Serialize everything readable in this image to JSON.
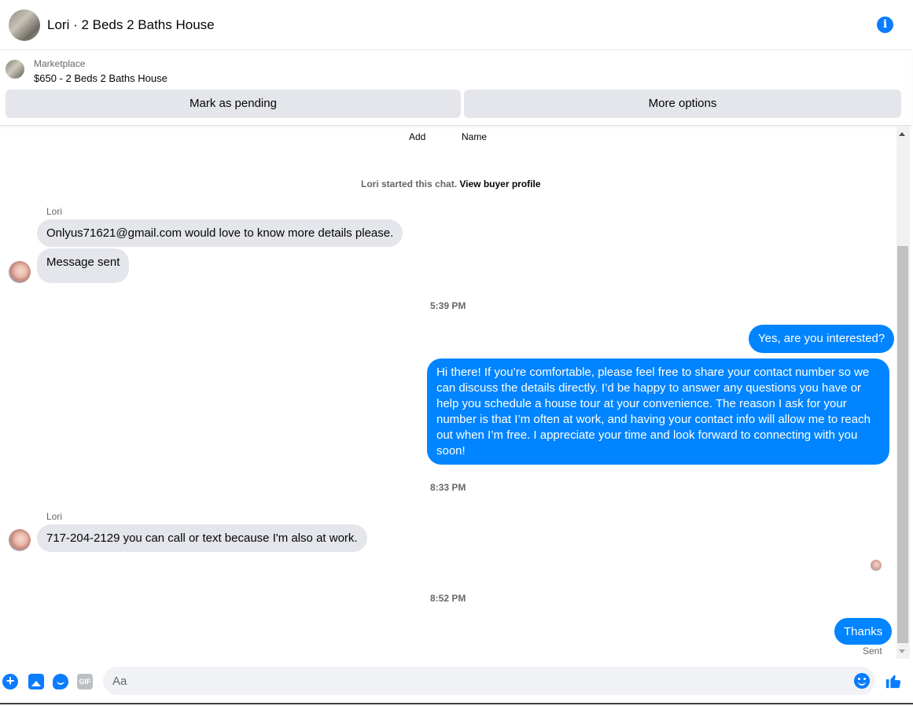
{
  "header": {
    "title": "Lori · 2 Beds 2 Baths House",
    "info_icon": "info-icon",
    "info_glyph": "i"
  },
  "marketplace": {
    "label": "Marketplace",
    "listing": "$650 - 2 Beds 2 Baths House",
    "mark_pending_label": "Mark as pending",
    "more_options_label": "More options"
  },
  "chat": {
    "top_links": {
      "add": "Add",
      "name": "Name"
    },
    "started_text": "Lori started this chat.",
    "view_profile_link": "View buyer profile",
    "messages": [
      {
        "sender": "Lori",
        "direction": "in",
        "text": "Onlyus71621@gmail.com would love to know more details please."
      },
      {
        "direction": "in",
        "text": "Message sent"
      },
      {
        "timestamp": "5:39 PM"
      },
      {
        "direction": "out",
        "text": "Yes, are you interested?"
      },
      {
        "direction": "out",
        "text": "Hi there! If you’re comfortable, please feel free to share your contact number so we can discuss the details directly. I’d be happy to answer any questions you have or help you schedule a house tour at your convenience. The reason I ask for your number is that I’m often at work, and having your contact info will allow me to reach out when I’m free. I appreciate your time and look forward to connecting with you soon!"
      },
      {
        "timestamp": "8:33 PM"
      },
      {
        "sender": "Lori",
        "direction": "in",
        "text": "717-204-2129 you can call or text because I'm also at work."
      },
      {
        "timestamp": "8:52 PM"
      },
      {
        "direction": "out",
        "text": "Thanks",
        "status": "Sent"
      }
    ]
  },
  "composer": {
    "placeholder": "Aa",
    "plus_glyph": "+",
    "gif_label": "GIF",
    "icons": [
      "plus-icon",
      "photo-icon",
      "sticker-icon",
      "gif-icon",
      "emoji-icon",
      "thumbs-up-icon"
    ]
  },
  "colors": {
    "accent": "#0084ff",
    "incoming_bubble": "#e4e6eb",
    "button_bg": "#e4e6eb"
  }
}
